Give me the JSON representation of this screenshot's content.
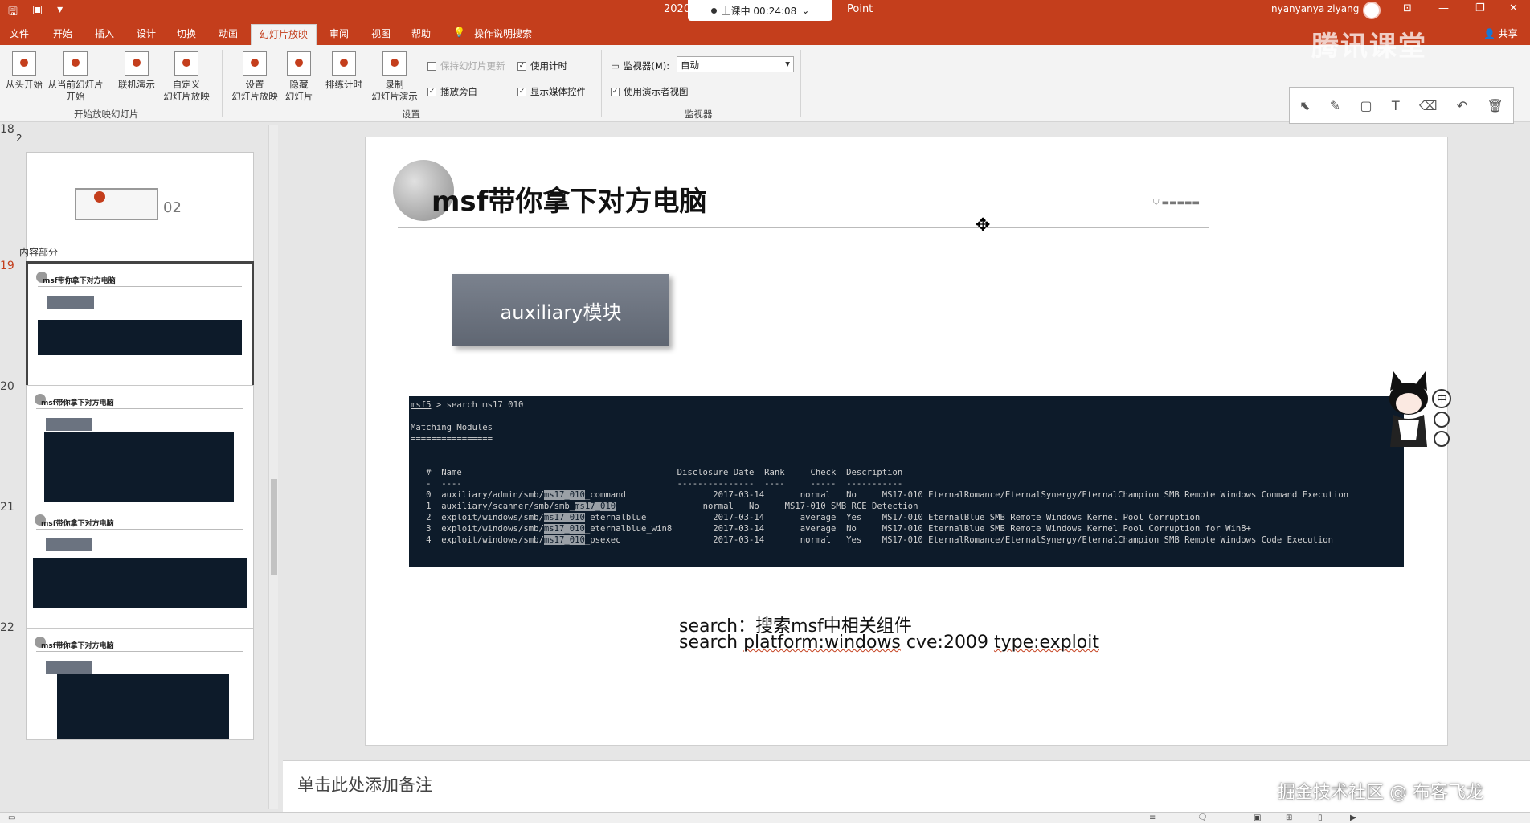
{
  "titlebar": {
    "doc_title": "2020",
    "doc_title_suffix": "Point",
    "timer": "上课中 00:24:08",
    "user": "nyanyanya ziyang"
  },
  "tabs": [
    "文件",
    "开始",
    "插入",
    "设计",
    "切换",
    "动画",
    "幻灯片放映",
    "审阅",
    "视图",
    "帮助",
    "操作说明搜索"
  ],
  "share_label": "共享",
  "ribbon": {
    "buttons": [
      {
        "label1": "从头开始",
        "label2": ""
      },
      {
        "label1": "从当前幻灯片",
        "label2": "开始"
      },
      {
        "label1": "联机演示",
        "label2": ""
      },
      {
        "label1": "自定义",
        "label2": "幻灯片放映"
      },
      {
        "label1": "设置",
        "label2": "幻灯片放映"
      },
      {
        "label1": "隐藏",
        "label2": "幻灯片"
      },
      {
        "label1": "排练计时",
        "label2": ""
      },
      {
        "label1": "录制",
        "label2": "幻灯片演示"
      }
    ],
    "group_start": "开始放映幻灯片",
    "group_setup": "设置",
    "group_monitor": "监视器",
    "check_keep_updated": "保持幻灯片更新",
    "check_use_timing": "使用计时",
    "check_narration": "播放旁白",
    "check_media_controls": "显示媒体控件",
    "monitor_label": "监视器(M):",
    "monitor_value": "自动",
    "check_presenter_view": "使用演示者视图"
  },
  "tencent_logo": "腾讯课堂",
  "thumbs": {
    "section_2": "2",
    "section_content": "内容部分",
    "nums": [
      "18",
      "19",
      "20",
      "21",
      "22"
    ],
    "slide_title": "msf带你拿下对方电脑"
  },
  "slide": {
    "title": "msf带你拿下对方电脑",
    "module_button": "auxiliary模块",
    "caption1": "search：搜索msf中相关组件",
    "caption2_a": "search ",
    "caption2_b": "platform:windows",
    "caption2_c": " cve:2009 ",
    "caption2_d": "type:exploit",
    "terminal": {
      "prompt": "msf5",
      "cmd": " > search ms17 010",
      "heading": "Matching Modules",
      "rule": "================",
      "header": "   #  Name                                          Disclosure Date  Rank     Check  Description",
      "dashes": "   -  ----                                          ---------------  ----     -----  -----------",
      "rows": [
        {
          "pre": "   0  auxiliary/admin/smb/",
          "hl": "ms17_010",
          "post": "_command                 2017-03-14       normal   No     MS17-010 EternalRomance/EternalSynergy/EternalChampion SMB Remote Windows Command Execution"
        },
        {
          "pre": "   1  auxiliary/scanner/smb/smb_",
          "hl": "ms17_010",
          "post": "                 normal   No     MS17-010 SMB RCE Detection"
        },
        {
          "pre": "   2  exploit/windows/smb/",
          "hl": "ms17_010",
          "post": "_eternalblue             2017-03-14       average  Yes    MS17-010 EternalBlue SMB Remote Windows Kernel Pool Corruption"
        },
        {
          "pre": "   3  exploit/windows/smb/",
          "hl": "ms17_010",
          "post": "_eternalblue_win8        2017-03-14       average  No     MS17-010 EternalBlue SMB Remote Windows Kernel Pool Corruption for Win8+"
        },
        {
          "pre": "   4  exploit/windows/smb/",
          "hl": "ms17_010",
          "post": "_psexec                  2017-03-14       normal   Yes    MS17-010 EternalRomance/EternalSynergy/EternalChampion SMB Remote Windows Code Execution"
        }
      ],
      "end_prompt": " > "
    }
  },
  "notes_placeholder": "单击此处添加备注",
  "watermark": "掘金技术社区 @ 布客飞龙"
}
